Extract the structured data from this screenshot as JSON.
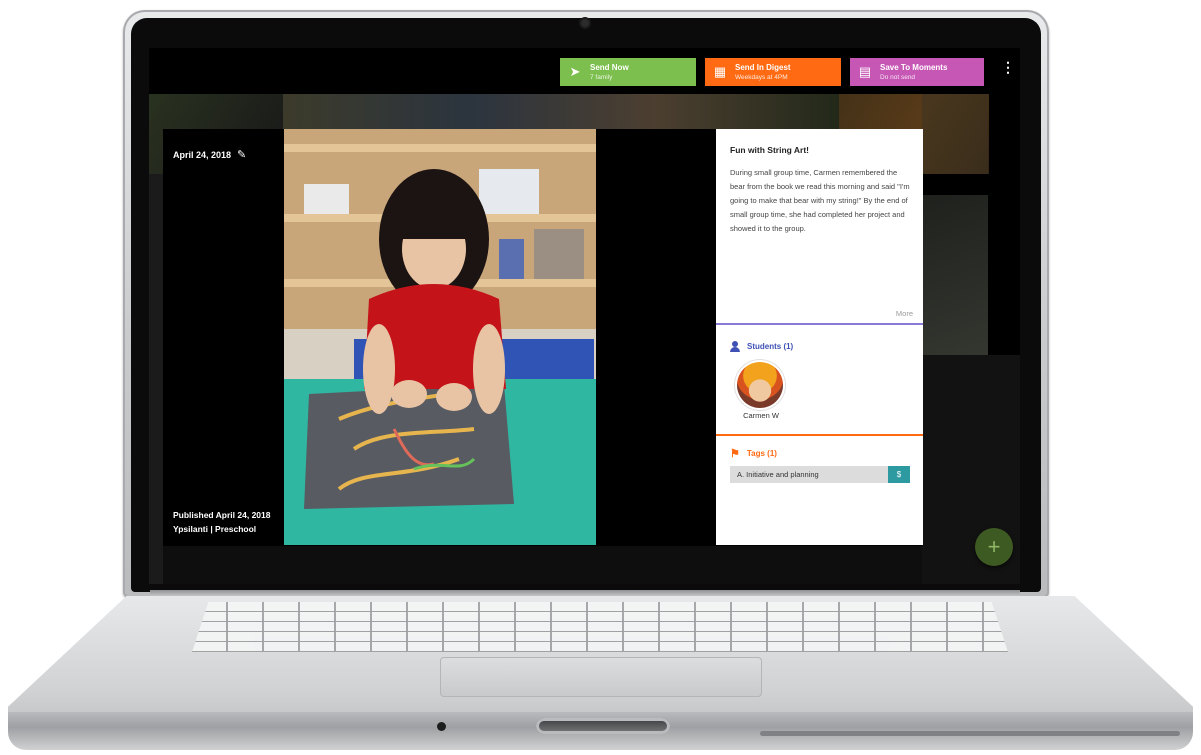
{
  "toolbar": {
    "send_now": {
      "title": "Send Now",
      "subtitle": "7 family",
      "icon": "paper-plane-icon",
      "color": "#7dbf4e"
    },
    "send_digest": {
      "title": "Send In Digest",
      "subtitle": "Weekdays at 4PM",
      "icon": "calendar-icon",
      "color": "#ff6a13"
    },
    "save_moments": {
      "title": "Save To Moments",
      "subtitle": "Do not send",
      "icon": "bookmark-icon",
      "color": "#c757b5"
    },
    "menu_icon": "more-vertical-icon"
  },
  "viewer": {
    "date": "April 24, 2018",
    "published": "Published April 24, 2018",
    "location": "Ypsilanti | Preschool"
  },
  "post": {
    "title": "Fun with String Art!",
    "body": "During small group time, Carmen remembered the bear from the book we read this morning and said \"I'm going to make that bear with my string!\" By the end of small group time, she had completed her project and showed it to the group.",
    "more": "More"
  },
  "students": {
    "heading": "Students (1)",
    "icon": "person-icon",
    "list": [
      {
        "name": "Carmen W"
      }
    ]
  },
  "tags": {
    "heading": "Tags (1)",
    "icon": "tag-icon",
    "list": [
      {
        "label": "A. Initiative and planning",
        "button": "$"
      }
    ]
  },
  "fab": {
    "label": "+"
  },
  "colors": {
    "students_accent": "#3f51b5",
    "tags_accent": "#ff6a13",
    "tag_button": "#2c9aa0"
  }
}
